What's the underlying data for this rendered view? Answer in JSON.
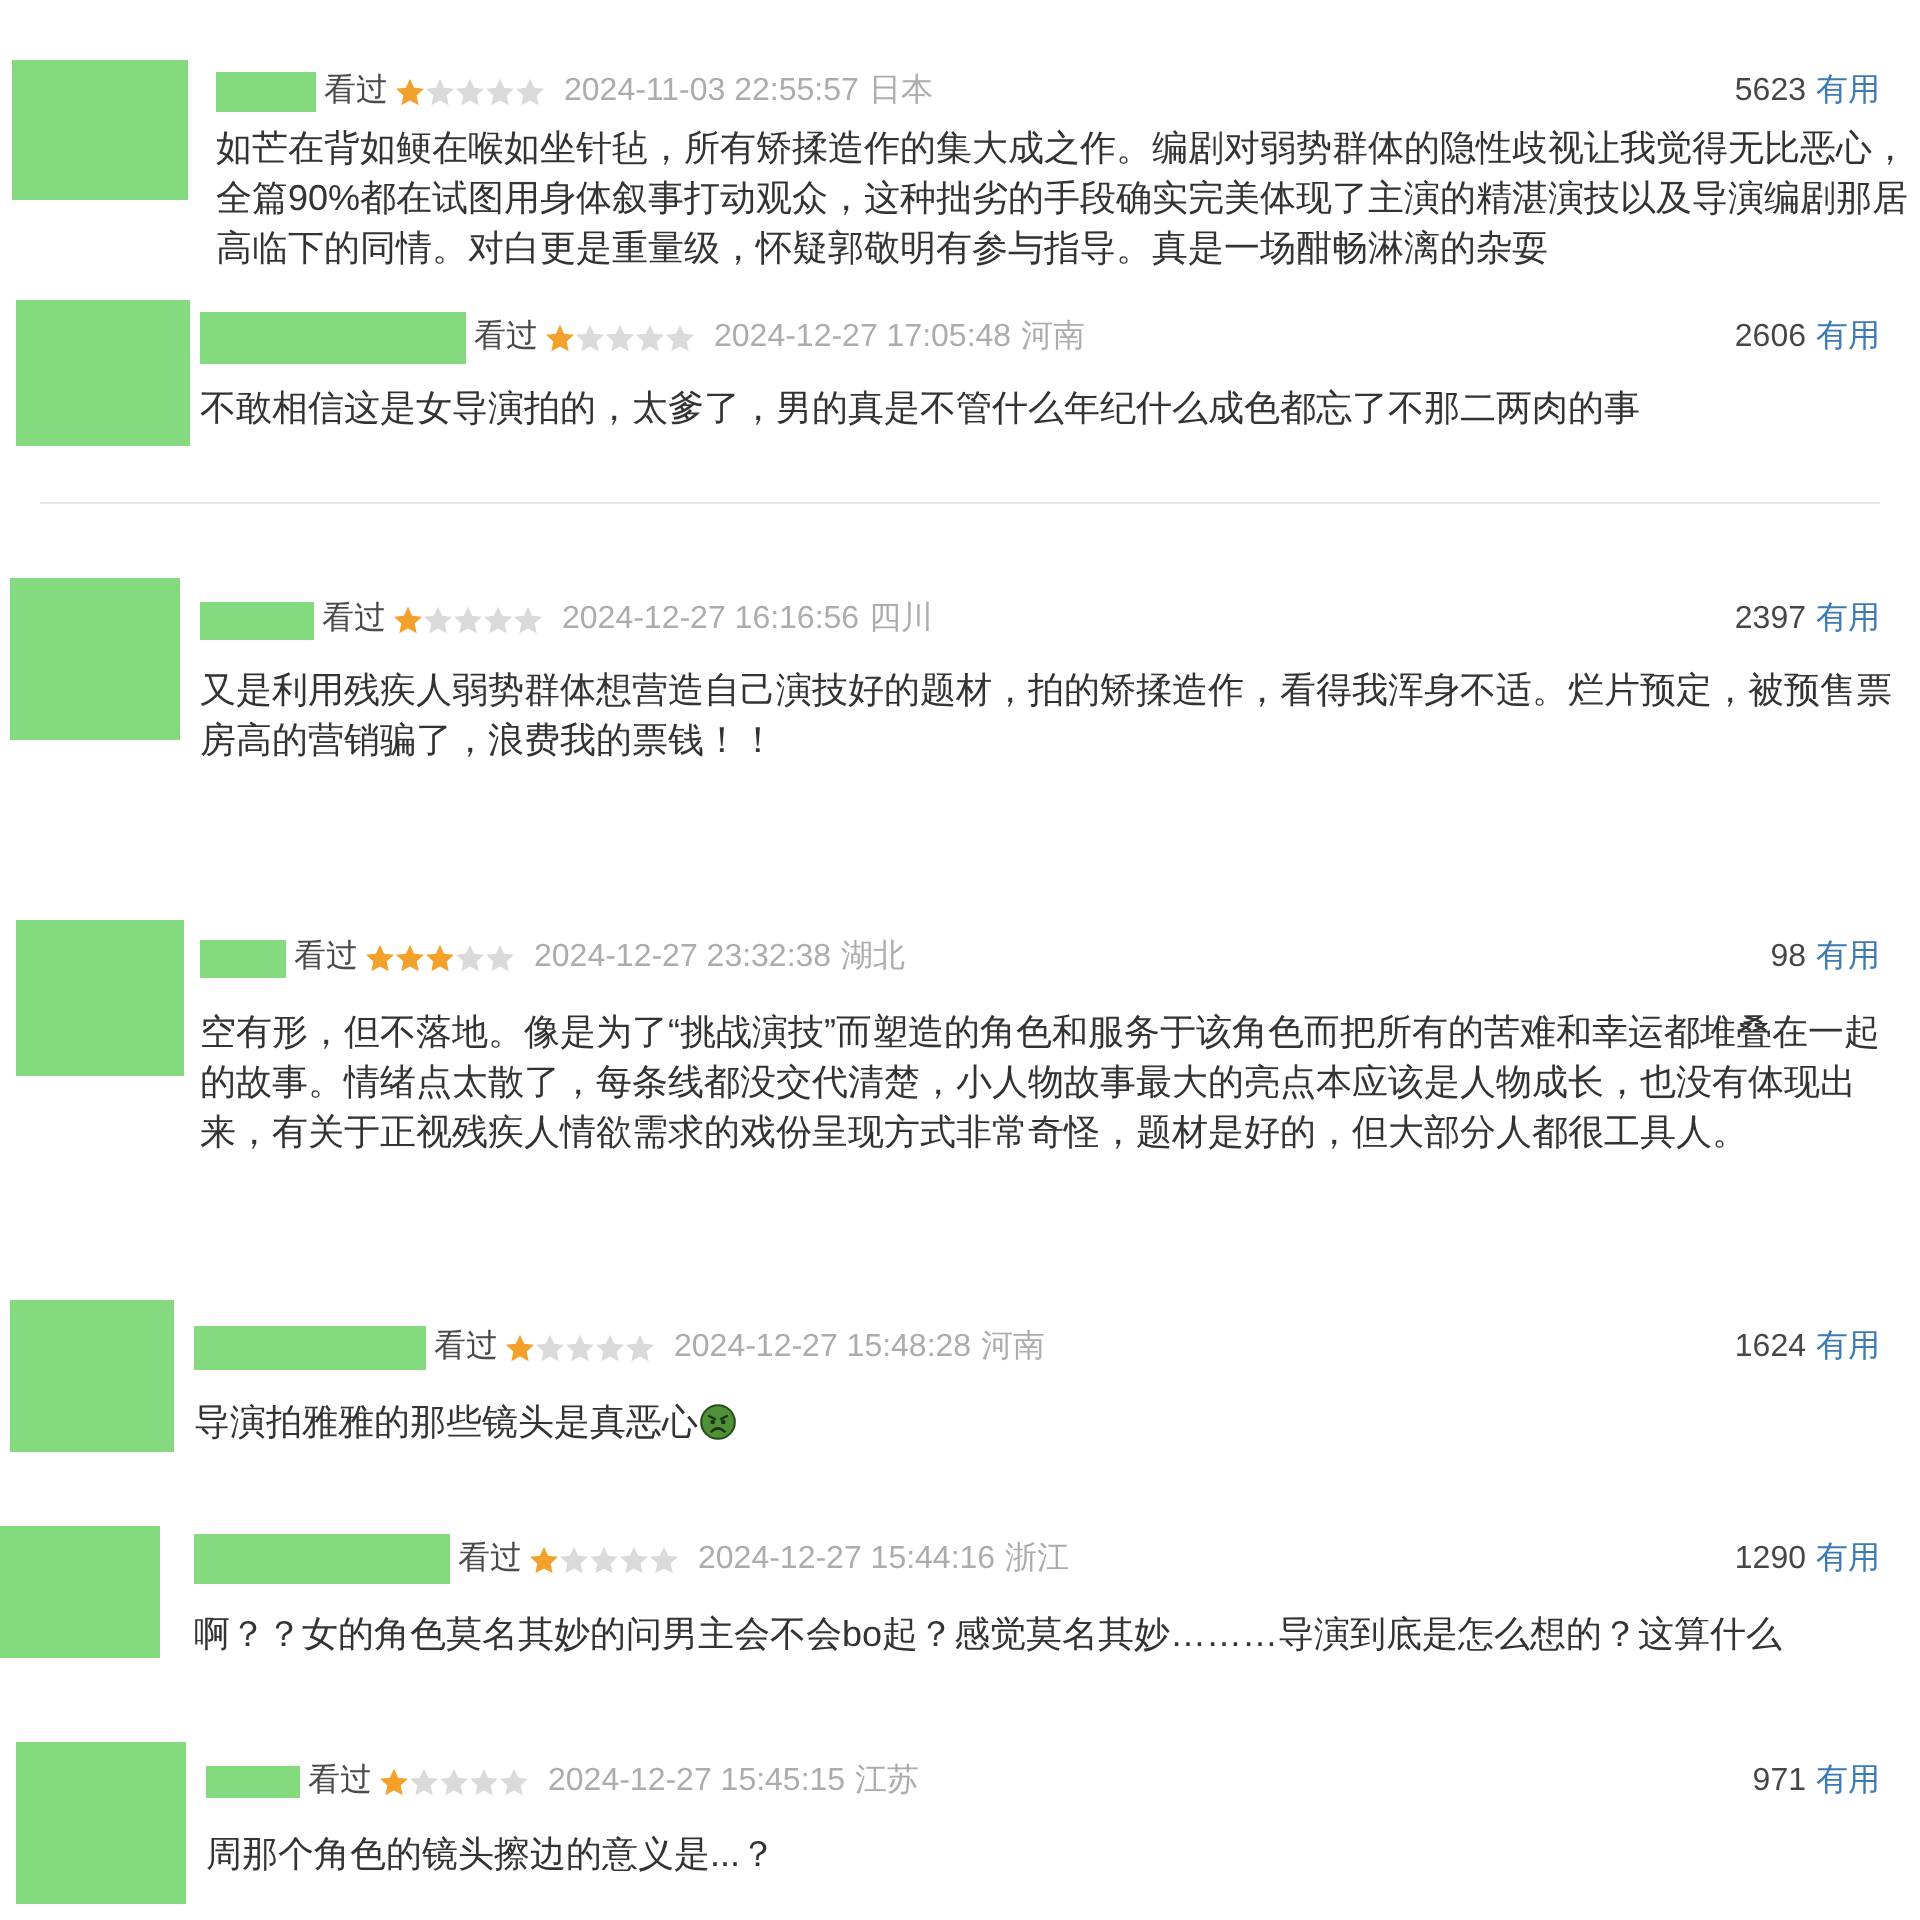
{
  "reviews": [
    {
      "status": "看过",
      "stars": 1,
      "time": "2024-11-03 22:55:57",
      "location": "日本",
      "useful_count": "5623",
      "useful_label": "有用",
      "text": "如芒在背如鲠在喉如坐针毡，所有矫揉造作的集大成之作。编剧对弱势群体的隐性歧视让我觉得无比恶心，全篇90%都在试图用身体叙事打动观众，这种拙劣的手段确实完美体现了主演的精湛演技以及导演编剧那居高临下的同情。对白更是重量级，怀疑郭敬明有参与指导。真是一场酣畅淋漓的杂耍",
      "emoji": false,
      "divider_below": false
    },
    {
      "status": "看过",
      "stars": 1,
      "time": "2024-12-27 17:05:48",
      "location": "河南",
      "useful_count": "2606",
      "useful_label": "有用",
      "text": "不敢相信这是女导演拍的，太爹了，男的真是不管什么年纪什么成色都忘了不那二两肉的事",
      "emoji": false,
      "divider_below": true
    },
    {
      "status": "看过",
      "stars": 1,
      "time": "2024-12-27 16:16:56",
      "location": "四川",
      "useful_count": "2397",
      "useful_label": "有用",
      "text": "又是利用残疾人弱势群体想营造自己演技好的题材，拍的矫揉造作，看得我浑身不适。烂片预定，被预售票房高的营销骗了，浪费我的票钱！！",
      "emoji": false,
      "divider_below": false
    },
    {
      "status": "看过",
      "stars": 3,
      "time": "2024-12-27 23:32:38",
      "location": "湖北",
      "useful_count": "98",
      "useful_label": "有用",
      "text": "空有形，但不落地。像是为了“挑战演技”而塑造的角色和服务于该角色而把所有的苦难和幸运都堆叠在一起的故事。情绪点太散了，每条线都没交代清楚，小人物故事最大的亮点本应该是人物成长，也没有体现出来，有关于正视残疾人情欲需求的戏份呈现方式非常奇怪，题材是好的，但大部分人都很工具人。",
      "emoji": false,
      "divider_below": false
    },
    {
      "status": "看过",
      "stars": 1,
      "time": "2024-12-27 15:48:28",
      "location": "河南",
      "useful_count": "1624",
      "useful_label": "有用",
      "text": "导演拍雅雅的那些镜头是真恶心",
      "emoji": true,
      "divider_below": false
    },
    {
      "status": "看过",
      "stars": 1,
      "time": "2024-12-27 15:44:16",
      "location": "浙江",
      "useful_count": "1290",
      "useful_label": "有用",
      "text": "啊？？女的角色莫名其妙的问男主会不会bo起？感觉莫名其妙………导演到底是怎么想的？这算什么",
      "emoji": false,
      "divider_below": false
    },
    {
      "status": "看过",
      "stars": 1,
      "time": "2024-12-27 15:45:15",
      "location": "江苏",
      "useful_count": "971",
      "useful_label": "有用",
      "text": "周那个角色的镜头擦边的意义是...？",
      "emoji": false,
      "divider_below": false
    }
  ]
}
